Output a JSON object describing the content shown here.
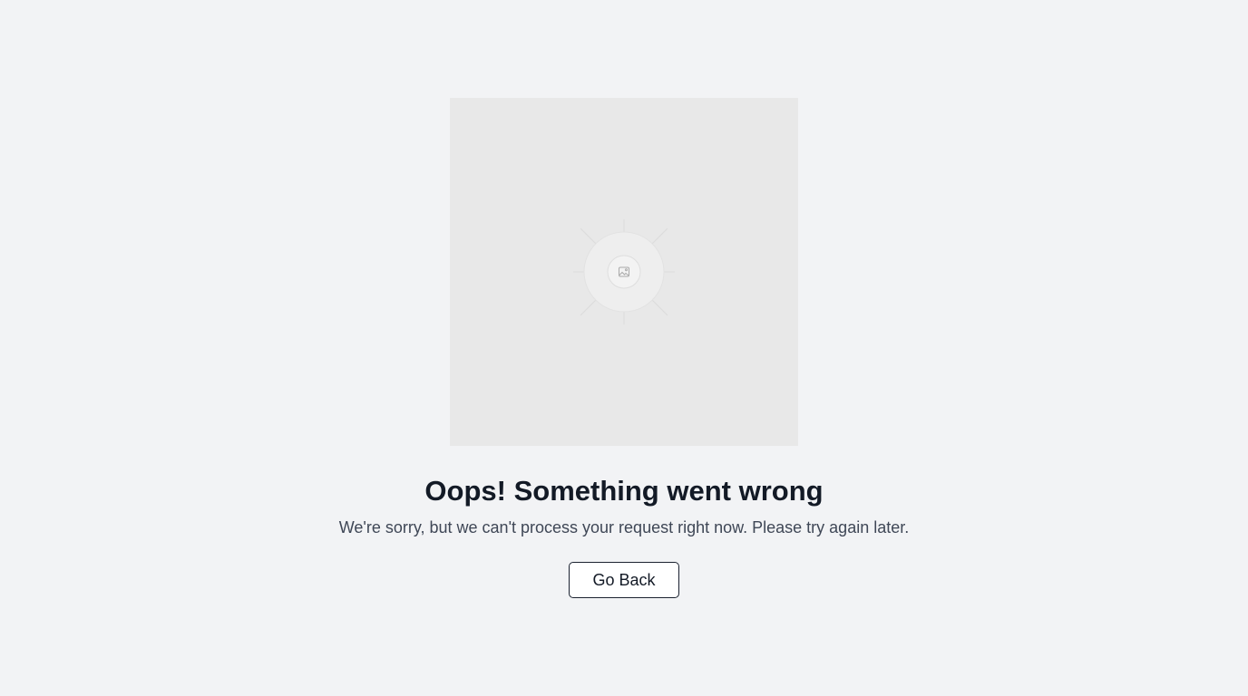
{
  "error": {
    "title": "Oops! Something went wrong",
    "message": "We're sorry, but we can't process your request right now. Please try again later.",
    "back_button_label": "Go Back"
  },
  "illustration": {
    "icon": "image-placeholder-icon",
    "background_color": "#e8e8e8"
  },
  "colors": {
    "page_background": "#f2f3f5",
    "title": "#131a26",
    "message": "#3f4756",
    "button_border": "#1b2230"
  }
}
